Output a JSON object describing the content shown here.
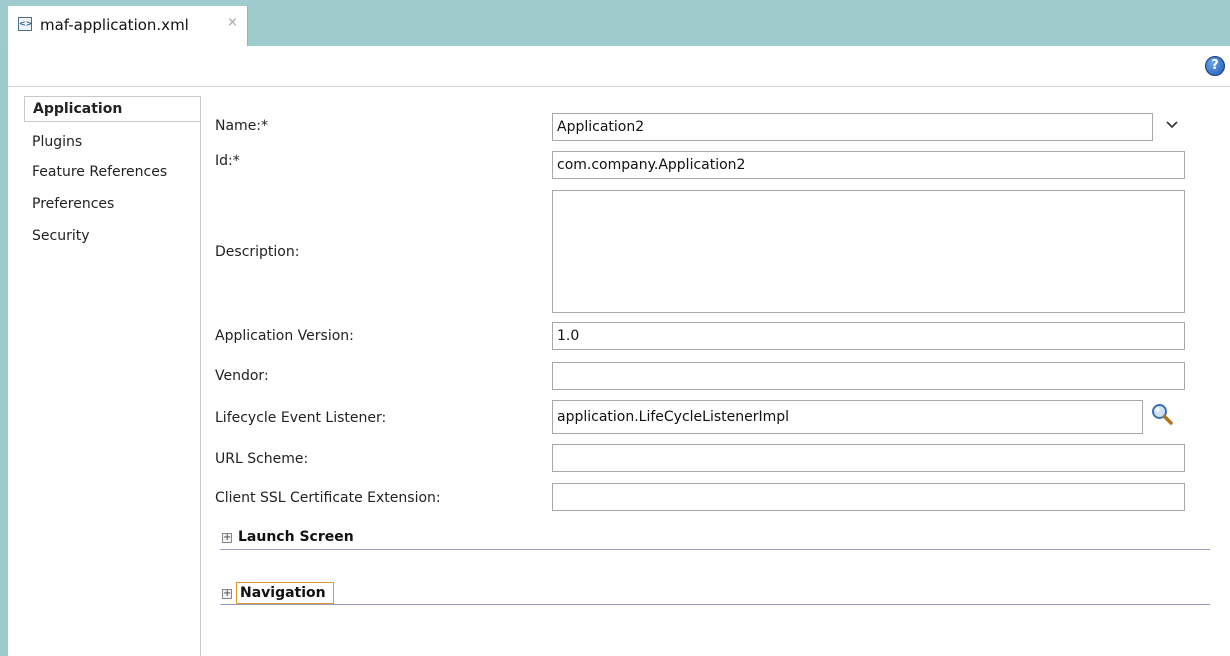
{
  "editor": {
    "tab_title": "maf-application.xml",
    "tab_close": "×",
    "help": "?"
  },
  "nav": {
    "items": [
      {
        "label": "Application",
        "active": true
      },
      {
        "label": "Plugins",
        "active": false
      },
      {
        "label": "Feature References",
        "active": false
      },
      {
        "label": "Preferences",
        "active": false
      },
      {
        "label": "Security",
        "active": false
      }
    ]
  },
  "form": {
    "name_label": "Name:*",
    "name_value": "Application2",
    "id_label": "Id:*",
    "id_value": "com.company.Application2",
    "description_label": "Description:",
    "description_value": "",
    "version_label": "Application Version:",
    "version_value": "1.0",
    "vendor_label": "Vendor:",
    "vendor_value": "",
    "listener_label": "Lifecycle Event Listener:",
    "listener_value": "application.LifeCycleListenerImpl",
    "url_scheme_label": "URL Scheme:",
    "url_scheme_value": "",
    "ssl_label": "Client SSL Certificate Extension:",
    "ssl_value": ""
  },
  "sections": {
    "launch_screen": "Launch Screen",
    "navigation": "Navigation",
    "expand_glyph": "+"
  },
  "colors": {
    "tabbar": "#9ecccd",
    "focus": "#e09a2b",
    "section_rule": "#9a9ac4"
  }
}
